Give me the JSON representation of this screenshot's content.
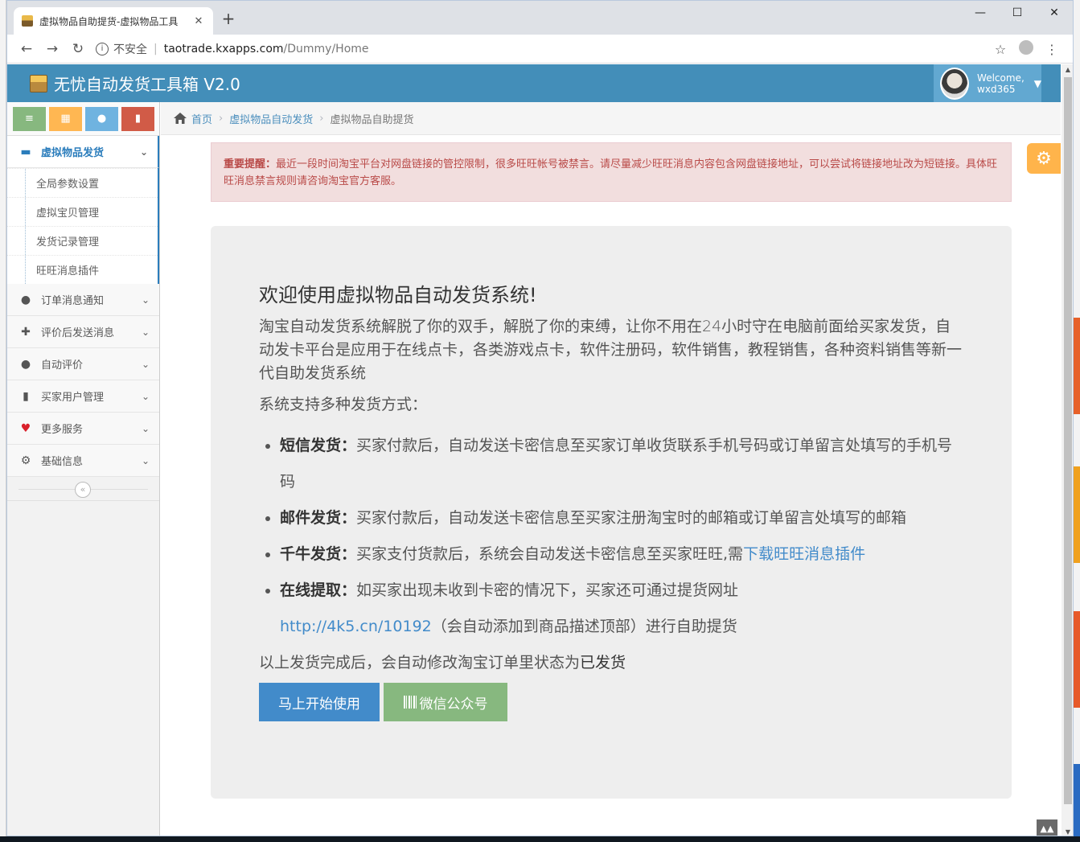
{
  "browser": {
    "tab_title": "虚拟物品自助提货-虚拟物品工具",
    "tab_close": "✕",
    "new_tab": "+",
    "minimize": "—",
    "maximize": "☐",
    "close": "✕",
    "back": "←",
    "forward": "→",
    "reload": "↻",
    "info": "i",
    "insecure_label": "不安全",
    "separator": "|",
    "url_host": "taotrade.kxapps.com",
    "url_path": "/Dummy/Home",
    "star": "☆",
    "menu": "⋮"
  },
  "navbar": {
    "brand": "无忧自动发货工具箱 V2.0",
    "welcome": "Welcome,",
    "username": "wxd365",
    "caret": "▼"
  },
  "sidebar": {
    "shortcuts": [
      "≡",
      "▦",
      "●",
      "▮"
    ],
    "open_menu": {
      "label": "虚拟物品发货",
      "icon": "▬",
      "caret": "⌄"
    },
    "submenu": [
      "全局参数设置",
      "虚拟宝贝管理",
      "发货记录管理",
      "旺旺消息插件"
    ],
    "items": [
      {
        "label": "订单消息通知",
        "icon": "●",
        "caret": "⌄"
      },
      {
        "label": "评价后发送消息",
        "icon": "✚",
        "caret": "⌄"
      },
      {
        "label": "自动评价",
        "icon": "●",
        "caret": "⌄"
      },
      {
        "label": "买家用户管理",
        "icon": "▮",
        "caret": "⌄"
      },
      {
        "label": "更多服务",
        "icon": "♥",
        "caret": "⌄"
      },
      {
        "label": "基础信息",
        "icon": "⚙",
        "caret": "⌄"
      }
    ],
    "collapse": "«"
  },
  "breadcrumbs": {
    "home": "首页",
    "sep": "›",
    "level1": "虚拟物品自动发货",
    "current": "虚拟物品自助提货"
  },
  "alert": {
    "title": "重要提醒：",
    "text": "最近一段时间淘宝平台对网盘链接的管控限制，很多旺旺帐号被禁言。请尽量减少旺旺消息内容包含网盘链接地址，可以尝试将链接地址改为短链接。具体旺旺消息禁言规则请咨询淘宝官方客服。"
  },
  "jumbo": {
    "heading": "欢迎使用虚拟物品自动发货系统!",
    "intro": "淘宝自动发货系统解脱了你的双手，解脱了你的束缚，让你不用在24小时守在电脑前面给买家发货，自动发卡平台是应用于在线点卡，各类游戏点卡，软件注册码，软件销售，教程销售，各种资料销售等新一代自助发货系统",
    "support": "系统支持多种发货方式：",
    "methods": [
      {
        "name": "短信发货：",
        "desc": "买家付款后，自动发送卡密信息至买家订单收货联系手机号码或订单留言处填写的手机号码"
      },
      {
        "name": "邮件发货：",
        "desc": "买家付款后，自动发送卡密信息至买家注册淘宝时的邮箱或订单留言处填写的邮箱"
      },
      {
        "name": "千牛发货：",
        "desc": "买家支付货款后，系统会自动发送卡密信息至买家旺旺,需",
        "link": "下载旺旺消息插件"
      },
      {
        "name": "在线提取：",
        "desc": "如买家出现未收到卡密的情况下，买家还可通过提货网址",
        "link": "http://4k5.cn/10192",
        "after": "（会自动添加到商品描述顶部）进行自助提货"
      }
    ],
    "final_prefix": "以上发货完成后，会自动修改淘宝订单里状态为",
    "final_status": "已发货",
    "start_button": "马上开始使用",
    "wechat_button": "微信公众号"
  },
  "settings_icon": "⚙",
  "scroll_top": "▲▲",
  "colors": {
    "navbar": "#438eb9",
    "user_box": "#62a8d1",
    "alert_bg": "#f2dede",
    "alert_text": "#b94a48",
    "primary": "#428bca",
    "success": "#87b87f",
    "warning": "#ffb752",
    "danger": "#d15b47",
    "info": "#6fb3e0"
  }
}
